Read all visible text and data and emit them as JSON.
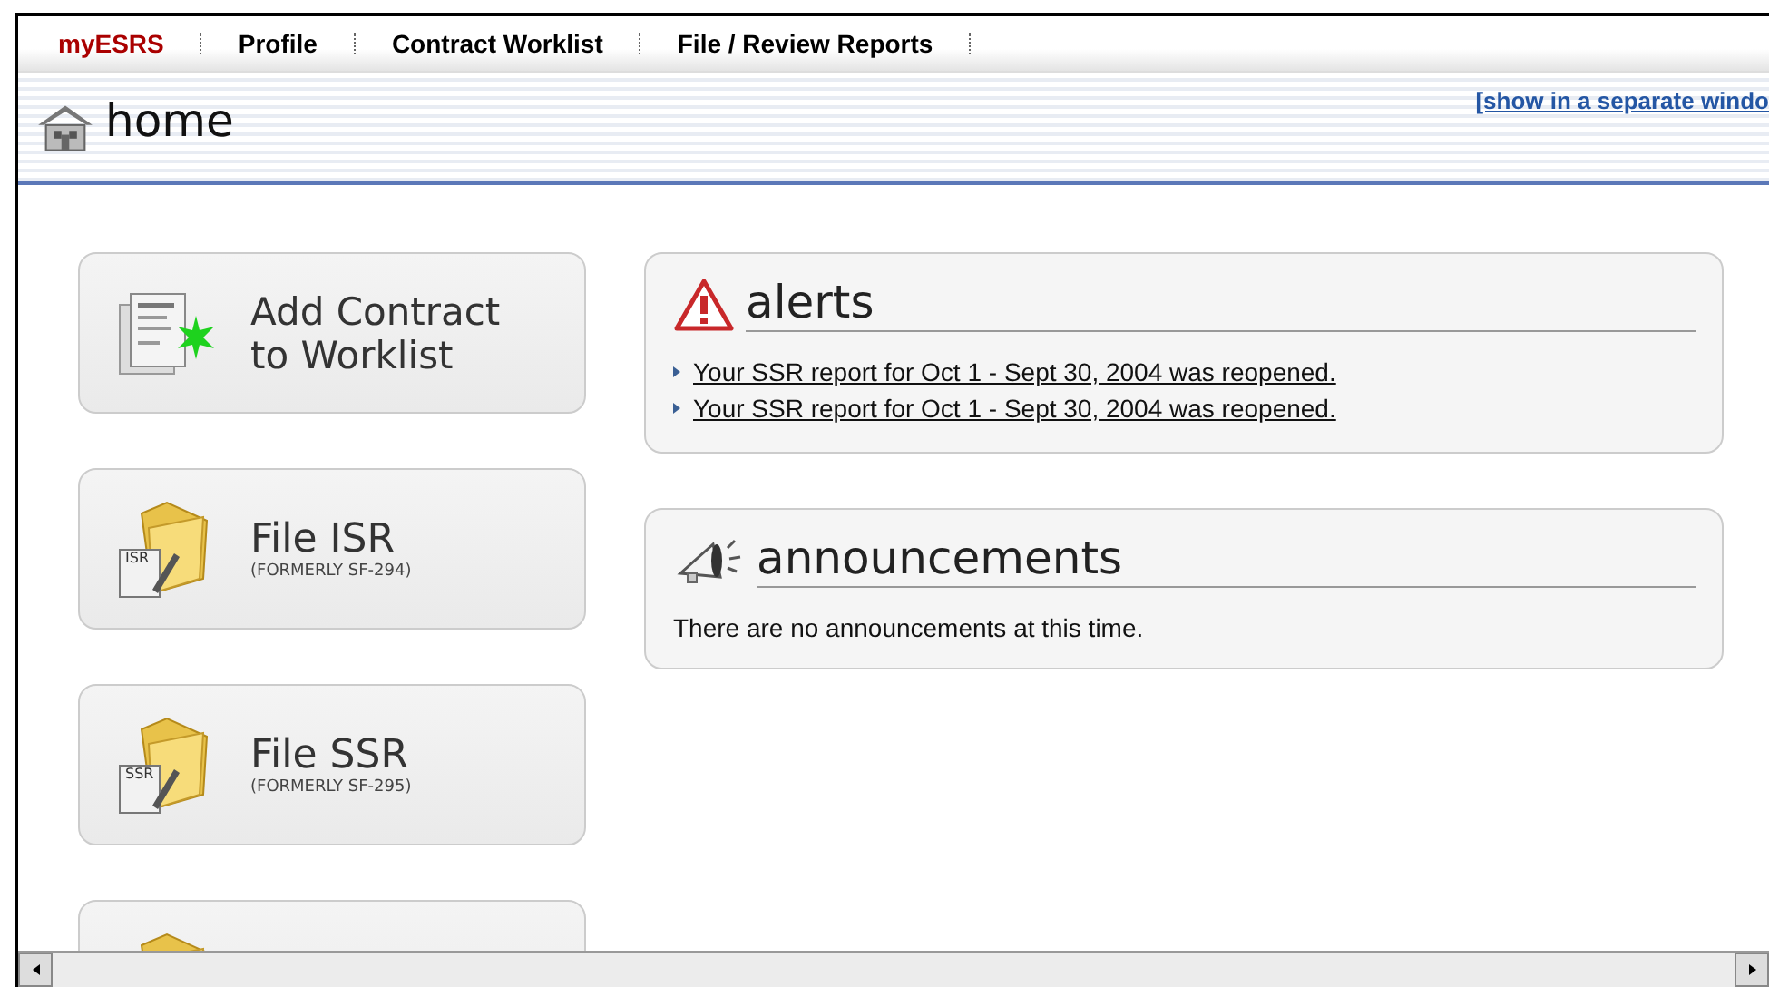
{
  "nav": [
    {
      "label": "myESRS",
      "selected": true
    },
    {
      "label": "Profile",
      "selected": false
    },
    {
      "label": "Contract Worklist",
      "selected": false
    },
    {
      "label": "File / Review Reports",
      "selected": false
    }
  ],
  "header": {
    "title": "home",
    "link": "[show in a separate windo"
  },
  "tiles": [
    {
      "kind": "add",
      "title": "Add Contract to Worklist"
    },
    {
      "kind": "folder",
      "title": "File ISR",
      "subtitle": "(FORMERLY SF-294)",
      "badge": "ISR"
    },
    {
      "kind": "folder",
      "title": "File SSR",
      "subtitle": "(FORMERLY SF-295)",
      "badge": "SSR"
    },
    {
      "kind": "folder-cut"
    }
  ],
  "alerts": {
    "title": "alerts",
    "items": [
      "Your SSR report for Oct 1 - Sept 30, 2004 was reopened.",
      "Your SSR report for Oct 1 - Sept 30, 2004 was reopened."
    ]
  },
  "announcements": {
    "title": "announcements",
    "text": "There are no announcements at this time."
  }
}
